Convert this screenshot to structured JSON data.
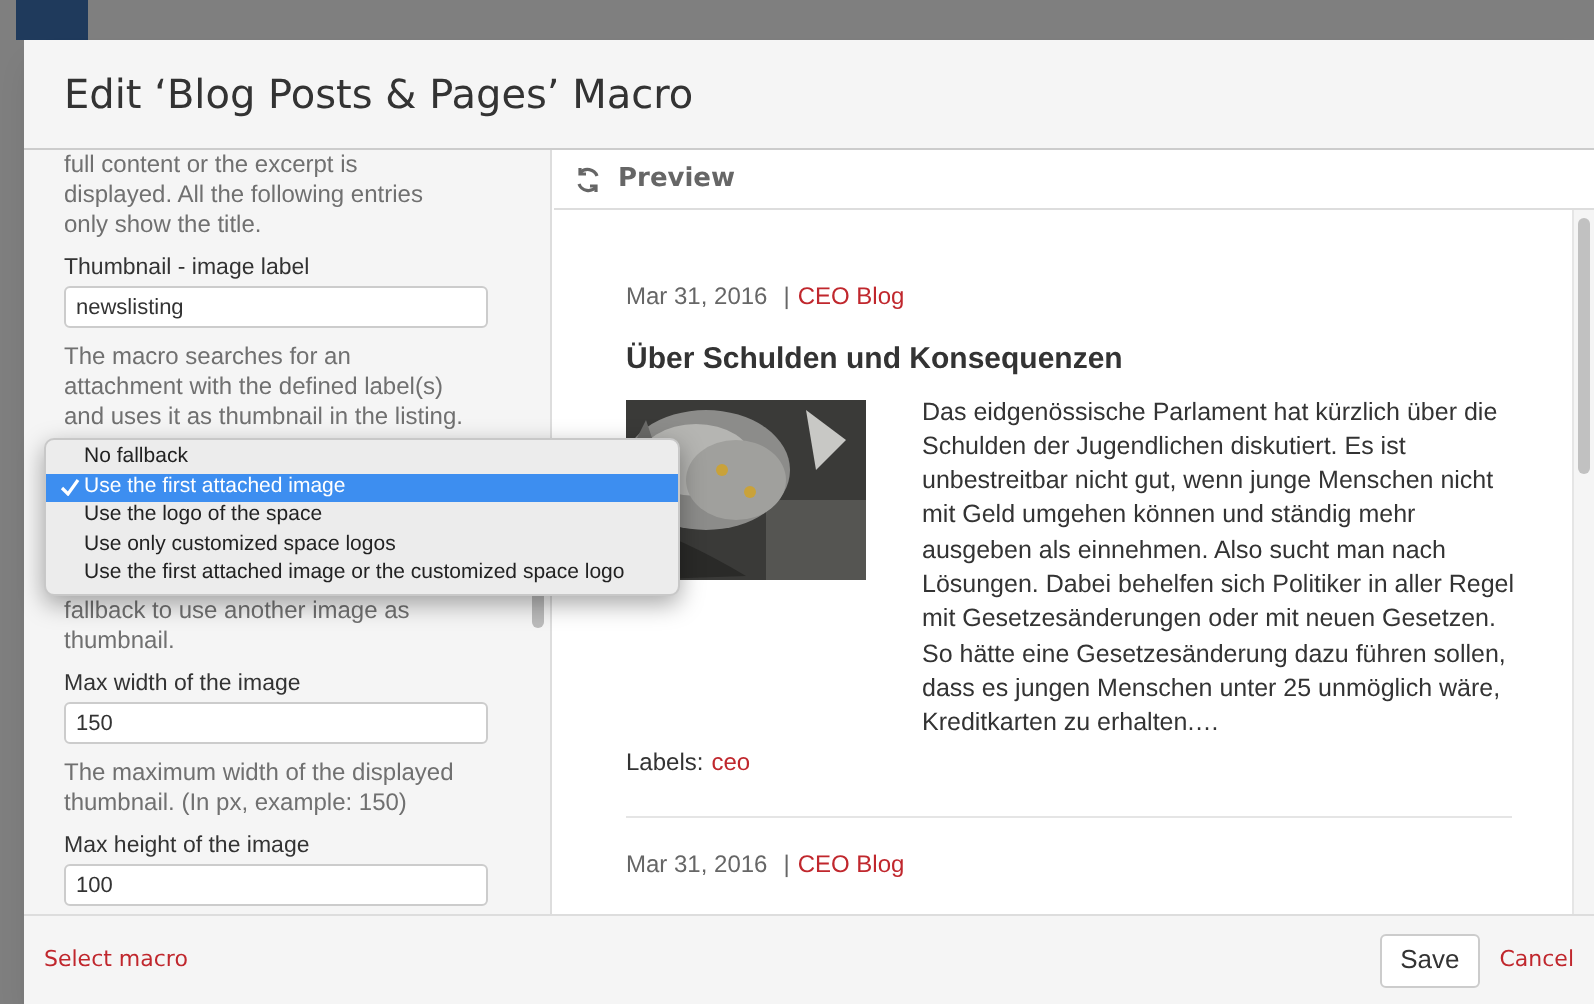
{
  "dialog": {
    "title": "Edit ‘Blog Posts & Pages’ Macro"
  },
  "form": {
    "items": [
      {
        "kind": "help",
        "text": "full content or the excerpt is\ndisplayed. All the following entries\nonly show the title."
      },
      {
        "kind": "field",
        "label": "Thumbnail - image label",
        "value": "newslisting"
      },
      {
        "kind": "help",
        "text": "The macro searches for an\nattachment with the defined label(s)\nand uses it as thumbnail in the listing."
      },
      {
        "kind": "covered",
        "text": "fallback to use another image as\nthumbnail."
      },
      {
        "kind": "field",
        "label": "Max width of the image",
        "value": "150"
      },
      {
        "kind": "help",
        "text": "The maximum width of the displayed\nthumbnail. (In px, example: 150)"
      },
      {
        "kind": "field",
        "label": "Max height of the image",
        "value": "100"
      }
    ]
  },
  "dropdown": {
    "options": [
      {
        "label": "No fallback",
        "selected": false
      },
      {
        "label": "Use the first attached image",
        "selected": true
      },
      {
        "label": "Use the logo of the space",
        "selected": false
      },
      {
        "label": "Use only customized space logos",
        "selected": false
      },
      {
        "label": "Use the first attached image or the customized space logo",
        "selected": false
      }
    ]
  },
  "preview": {
    "title": "Preview",
    "posts": [
      {
        "date": "Mar 31, 2016",
        "separator": "|",
        "blog": "CEO Blog",
        "title": "Über Schulden und Konsequenzen",
        "thumbnail": {
          "kind": "picture"
        },
        "excerpt": "Das eidgenössische Parlament hat kürzlich über die Schulden der Jugendlichen diskutiert. Es ist unbestreitbar nicht gut, wenn junge Menschen nicht mit Geld umgehen können und ständig mehr ausgeben als einnehmen. Also sucht man nach Lösungen. Dabei behelfen sich Politiker in aller Regel mit Gesetzesänderungen oder mit neuen Gesetzen. So hätte eine Gesetzesänderung dazu führen sollen, dass es jungen Menschen unter 25 unmöglich wäre, Kreditkarten zu erhalten.…",
        "labels_caption": "Labels:",
        "labels": [
          "ceo"
        ]
      },
      {
        "date": "Mar 31, 2016",
        "separator": "|",
        "blog": "CEO Blog"
      }
    ]
  },
  "footer": {
    "link": "Select macro",
    "save": "Save",
    "cancel": "Cancel"
  }
}
